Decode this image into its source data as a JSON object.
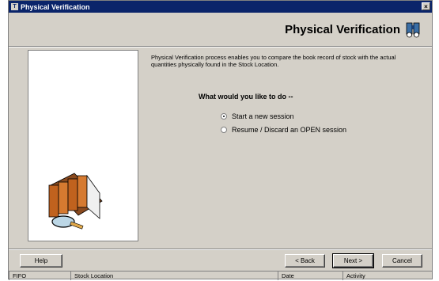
{
  "window": {
    "title": "Physical Verification",
    "close_glyph": "×"
  },
  "header": {
    "title": "Physical Verification",
    "icon": "binoculars-icon"
  },
  "content": {
    "description": "Physical Verification process enables you to compare the book record of stock with the actual quantities physically found in the Stock Location.",
    "question": "What would you like to do --",
    "options": [
      {
        "label": "Start a new session",
        "selected": true
      },
      {
        "label": "Resume / Discard an OPEN session",
        "selected": false
      }
    ],
    "illustration": "books-magnifier-icon"
  },
  "buttons": {
    "help": "Help",
    "back": "< Back",
    "next": "Next >",
    "cancel": "Cancel"
  },
  "status_bar": [
    "FIFO",
    "Stock Location",
    "Date",
    "Activity"
  ]
}
